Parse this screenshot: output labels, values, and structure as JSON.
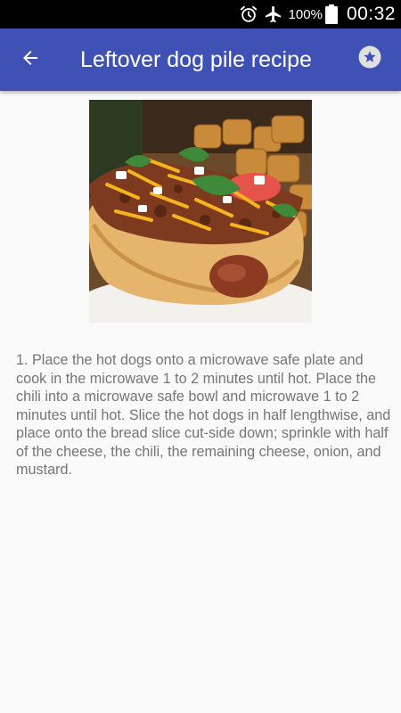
{
  "status_bar": {
    "battery_percent": "100%",
    "time": "00:32",
    "icons": [
      "alarm-icon",
      "airplane-icon",
      "battery-icon"
    ]
  },
  "toolbar": {
    "title": "Leftover dog pile recipe",
    "back_icon": "arrow-back-icon",
    "favorite_icon": "star-icon"
  },
  "recipe": {
    "image": "photo of a hot dog in a bun topped with chili, shredded cheddar cheese, diced onion and cilantro, with tater tots in the background",
    "instructions": "1. Place the hot dogs onto a microwave safe plate and cook in the microwave 1 to 2 minutes until hot. Place the chili into a microwave safe bowl and microwave 1 to 2 minutes until hot. Slice the hot dogs in half lengthwise, and place onto the bread slice cut-side down; sprinkle with half of the cheese, the chili, the remaining cheese, onion, and mustard."
  },
  "colors": {
    "app_bar": "#3f51b5",
    "status_bar": "#000000",
    "background": "#fafafa",
    "body_text": "#757575"
  }
}
